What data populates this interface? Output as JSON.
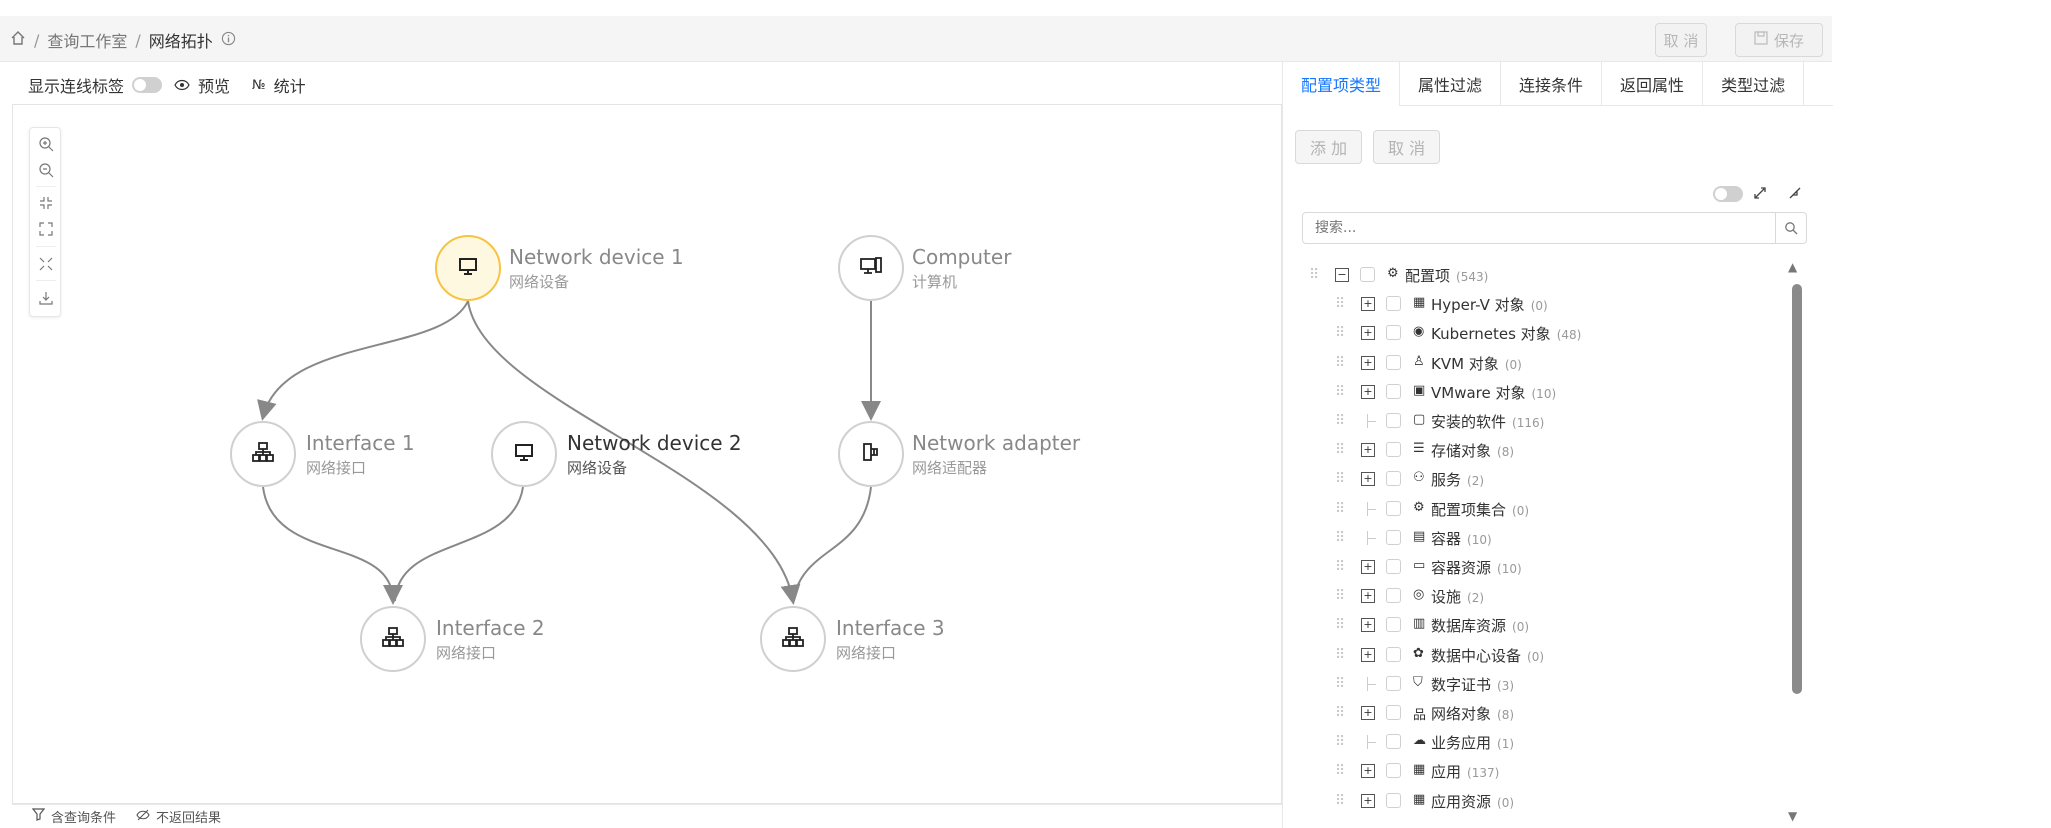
{
  "header": {
    "breadcrumb": [
      "查询工作室",
      "网络拓扑"
    ],
    "cancel_label": "取 消",
    "save_label": "保存"
  },
  "toolbar": {
    "show_edge_labels": "显示连线标签",
    "preview": "预览",
    "stats": "统计"
  },
  "graph": {
    "nodes": [
      {
        "title": "Network device 1",
        "subtitle": "网络设备",
        "icon": "monitor-icon"
      },
      {
        "title": "Computer",
        "subtitle": "计算机",
        "icon": "computer-icon"
      },
      {
        "title": "Interface 1",
        "subtitle": "网络接口",
        "icon": "network-icon"
      },
      {
        "title": "Network device 2",
        "subtitle": "网络设备",
        "icon": "monitor-icon"
      },
      {
        "title": "Network adapter",
        "subtitle": "网络适配器",
        "icon": "adapter-icon"
      },
      {
        "title": "Interface 2",
        "subtitle": "网络接口",
        "icon": "network-icon"
      },
      {
        "title": "Interface 3",
        "subtitle": "网络接口",
        "icon": "network-icon"
      }
    ]
  },
  "footer": {
    "has_conditions": "含查询条件",
    "no_results": "不返回结果"
  },
  "panel": {
    "tabs": [
      "配置项类型",
      "属性过滤",
      "连接条件",
      "返回属性",
      "类型过滤"
    ],
    "add_label": "添 加",
    "cancel_label": "取 消",
    "search_placeholder": "搜索...",
    "tree": [
      {
        "label": "配置项",
        "count": "(543)"
      },
      {
        "label": "Hyper-V 对象",
        "count": "(0)"
      },
      {
        "label": "Kubernetes 对象",
        "count": "(48)"
      },
      {
        "label": "KVM 对象",
        "count": "(0)"
      },
      {
        "label": "VMware 对象",
        "count": "(10)"
      },
      {
        "label": "安装的软件",
        "count": "(116)"
      },
      {
        "label": "存储对象",
        "count": "(8)"
      },
      {
        "label": "服务",
        "count": "(2)"
      },
      {
        "label": "配置项集合",
        "count": "(0)"
      },
      {
        "label": "容器",
        "count": "(10)"
      },
      {
        "label": "容器资源",
        "count": "(10)"
      },
      {
        "label": "设施",
        "count": "(2)"
      },
      {
        "label": "数据库资源",
        "count": "(0)"
      },
      {
        "label": "数据中心设备",
        "count": "(0)"
      },
      {
        "label": "数字证书",
        "count": "(3)"
      },
      {
        "label": "网络对象",
        "count": "(8)"
      },
      {
        "label": "业务应用",
        "count": "(1)"
      },
      {
        "label": "应用",
        "count": "(137)"
      },
      {
        "label": "应用资源",
        "count": "(0)"
      }
    ]
  },
  "colors": {
    "accent": "#1677ff",
    "selected_node_border": "#f5c443",
    "selected_node_fill": "#fff8e1"
  }
}
